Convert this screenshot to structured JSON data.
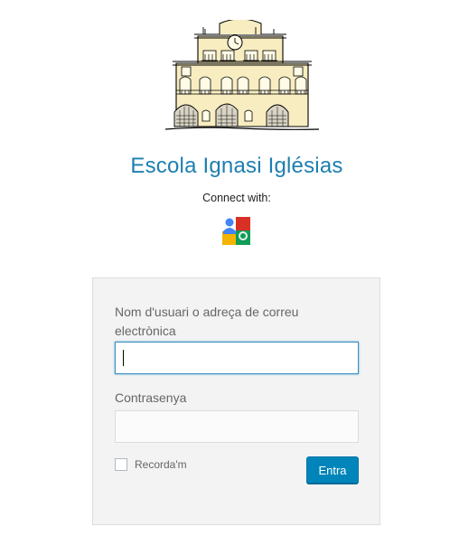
{
  "site": {
    "title": "Escola Ignasi Iglésias"
  },
  "social": {
    "connect_label": "Connect with:",
    "provider_icon": "google-icon"
  },
  "login_form": {
    "username_label": "Nom d'usuari o adreça de correu electrònica",
    "username_value": "",
    "password_label": "Contrasenya",
    "password_value": "",
    "remember_label": "Recorda'm",
    "remember_checked": false,
    "submit_label": "Entra"
  },
  "colors": {
    "title": "#1d7fb0",
    "primary_button": "#0085ba",
    "form_background": "#f3f3f3",
    "input_focus_border": "#3d8fc4"
  }
}
